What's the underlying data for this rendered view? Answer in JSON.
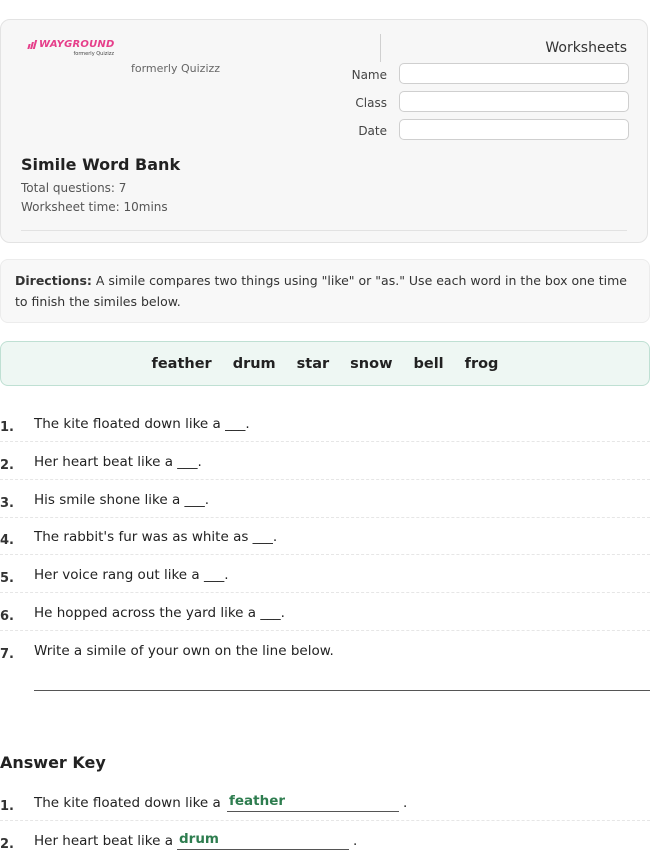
{
  "header": {
    "logo_text": "WAYGROUND",
    "logo_sub": "formerly Quizizz",
    "formerly": "formerly Quizizz",
    "worksheets": "Worksheets",
    "fields": [
      {
        "label": "Name",
        "value": ""
      },
      {
        "label": "Class",
        "value": ""
      },
      {
        "label": "Date",
        "value": ""
      }
    ],
    "title": "Simile Word Bank",
    "total_questions": "Total questions: 7",
    "worksheet_time": "Worksheet time: 10mins"
  },
  "directions": {
    "label": "Directions:",
    "text": " A simile compares two things using \"like\" or \"as.\" Use each word in the box one time to finish the similes below."
  },
  "word_bank": [
    "feather",
    "drum",
    "star",
    "snow",
    "bell",
    "frog"
  ],
  "questions": [
    {
      "num": "1.",
      "text": "The kite floated down like a ___."
    },
    {
      "num": "2.",
      "text": "Her heart beat like a ___."
    },
    {
      "num": "3.",
      "text": "His smile shone like a ___."
    },
    {
      "num": "4.",
      "text": "The rabbit's fur was as white as ___."
    },
    {
      "num": "5.",
      "text": "Her voice rang out like a ___."
    },
    {
      "num": "6.",
      "text": "He hopped across the yard like a ___."
    },
    {
      "num": "7.",
      "text": "Write a simile of your own on the line below."
    }
  ],
  "answer_key": {
    "title": "Answer Key",
    "answers": [
      {
        "num": "1.",
        "prefix": "The kite floated down like a",
        "answer": "feather",
        "suffix": "."
      },
      {
        "num": "2.",
        "prefix": "Her heart beat like a",
        "answer": "drum",
        "suffix": "."
      }
    ]
  }
}
